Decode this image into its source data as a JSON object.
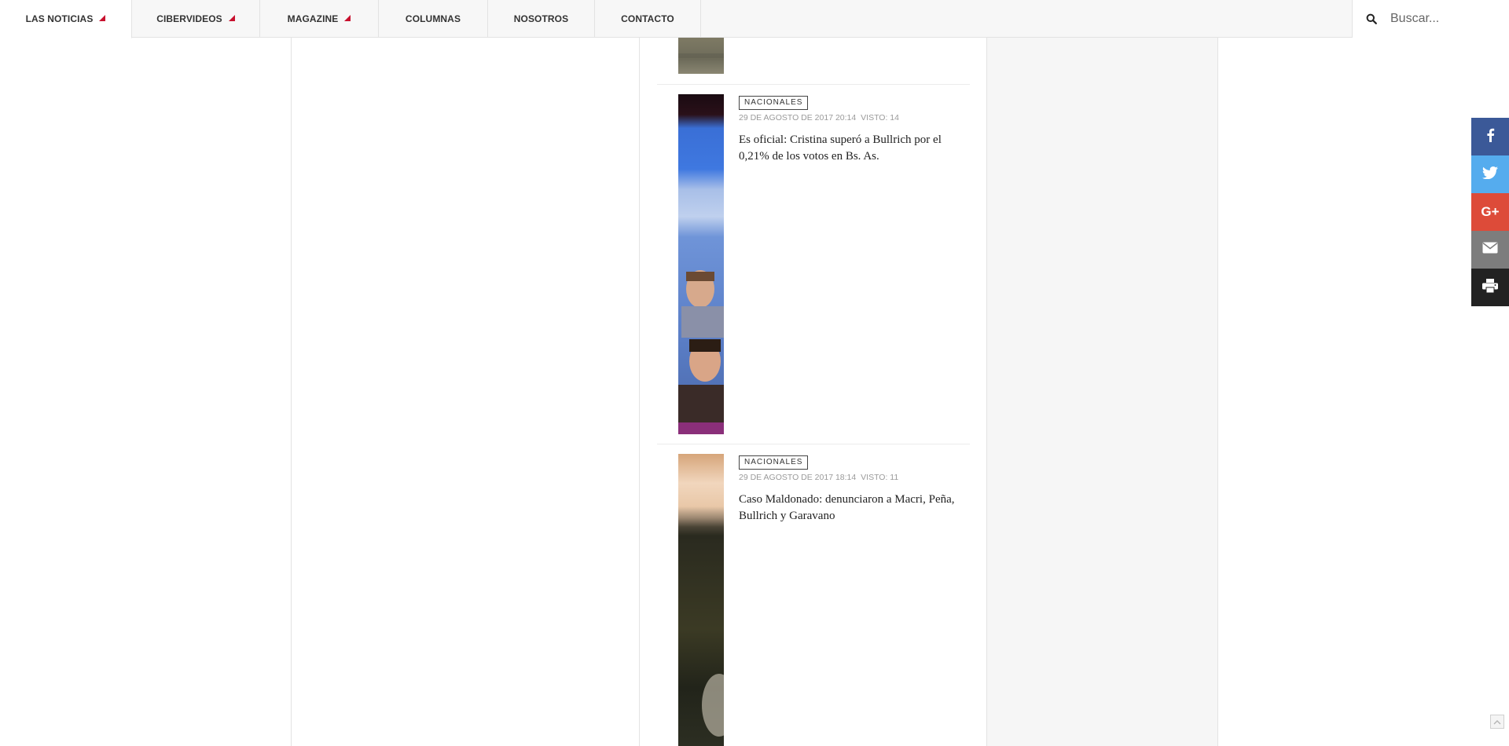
{
  "nav": {
    "items": [
      {
        "label": "LAS NOTICIAS",
        "has_caret": true,
        "active": true
      },
      {
        "label": "CIBERVIDEOS",
        "has_caret": true,
        "active": false
      },
      {
        "label": "MAGAZINE",
        "has_caret": true,
        "active": false
      },
      {
        "label": "COLUMNAS",
        "has_caret": false,
        "active": false
      },
      {
        "label": "NOSOTROS",
        "has_caret": false,
        "active": false
      },
      {
        "label": "CONTACTO",
        "has_caret": false,
        "active": false
      }
    ],
    "caret_color": "#c8102e"
  },
  "search": {
    "placeholder": "Buscar...",
    "icon": "search-icon"
  },
  "articles": [
    {
      "category": "NACIONALES",
      "date": "29 DE AGOSTO DE 2017 20:14",
      "views": "VISTO: 14",
      "title": "Es oficial: Cristina superó a Bullrich por el 0,21% de los votos en Bs. As."
    },
    {
      "category": "NACIONALES",
      "date": "29 DE AGOSTO DE 2017 18:14",
      "views": "VISTO: 11",
      "title": "Caso Maldonado: denunciaron a Macri, Peña, Bullrich y Garavano"
    }
  ],
  "share": [
    {
      "name": "facebook",
      "icon": "facebook-icon",
      "color": "#3b5998"
    },
    {
      "name": "twitter",
      "icon": "twitter-icon",
      "color": "#55acee"
    },
    {
      "name": "google-plus",
      "icon": "google-plus-icon",
      "color": "#dd4b39"
    },
    {
      "name": "email",
      "icon": "email-icon",
      "color": "#7d7d7d"
    },
    {
      "name": "print",
      "icon": "print-icon",
      "color": "#222222"
    }
  ]
}
